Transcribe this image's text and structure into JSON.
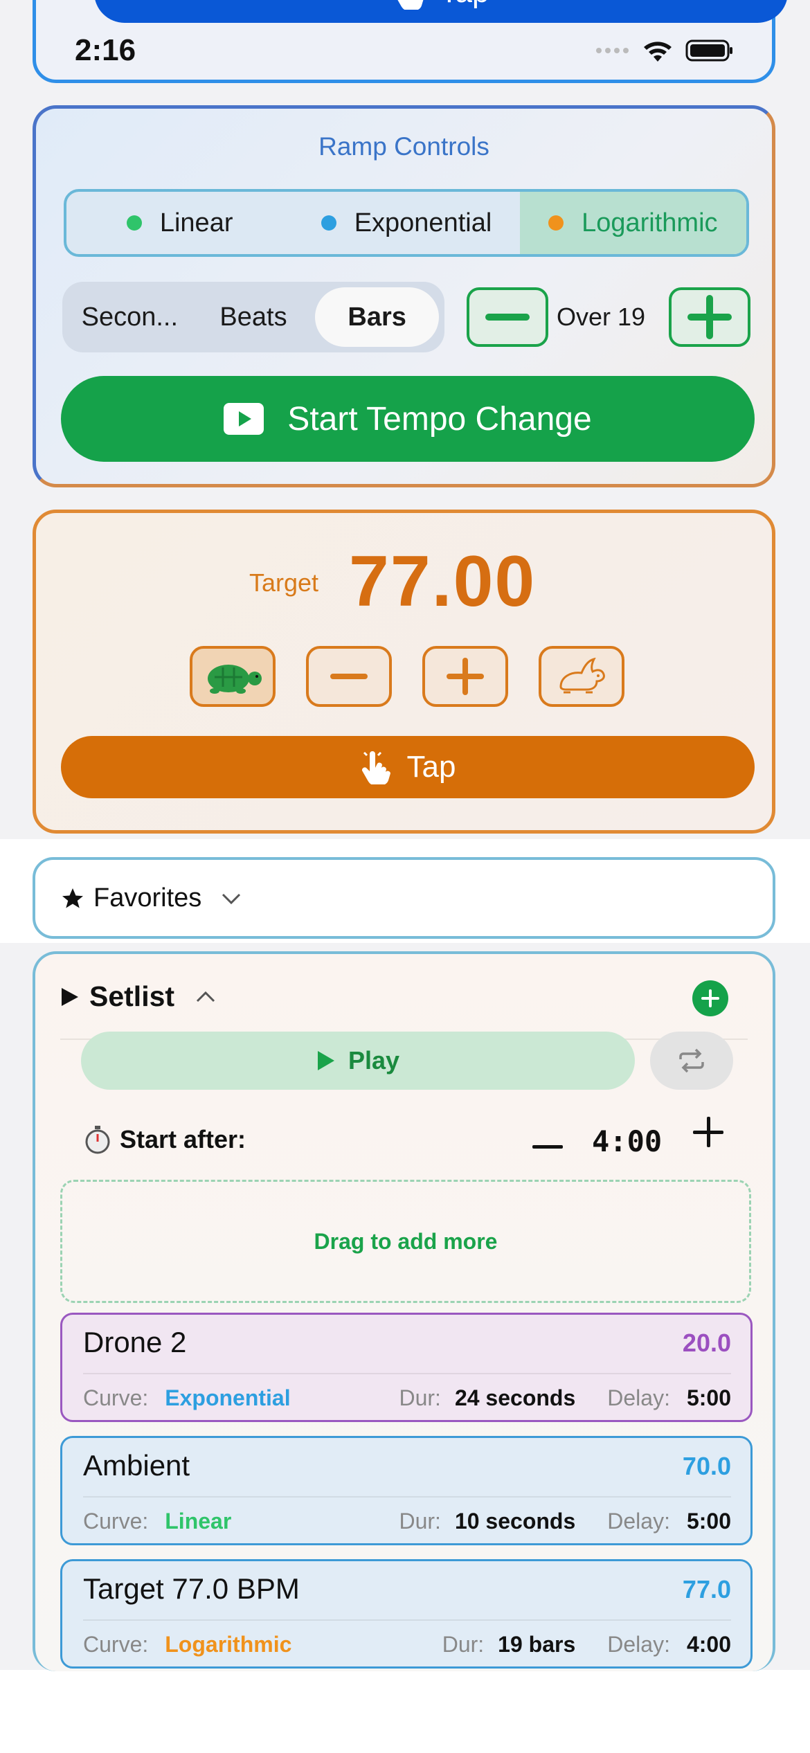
{
  "status_bar": {
    "time": "2:16"
  },
  "top_card": {
    "tap_label": "Tap"
  },
  "ramp": {
    "title": "Ramp Controls",
    "curves": [
      {
        "label": "Linear",
        "dot_color": "#2fc46a",
        "selected": false
      },
      {
        "label": "Exponential",
        "dot_color": "#2d9fe0",
        "selected": false
      },
      {
        "label": "Logarithmic",
        "dot_color": "#f0921c",
        "selected": true
      }
    ],
    "units": [
      {
        "label": "Secon...",
        "selected": false
      },
      {
        "label": "Beats",
        "selected": false
      },
      {
        "label": "Bars",
        "selected": true
      }
    ],
    "duration_label": "Over 19",
    "start_label": "Start Tempo Change"
  },
  "target": {
    "label": "Target",
    "value": "77.00",
    "tap_label": "Tap"
  },
  "favorites": {
    "label": "Favorites"
  },
  "setlist": {
    "title": "Setlist",
    "play_label": "Play",
    "start_after_label": "Start after:",
    "start_after_value": "4:00",
    "drop_zone_label": "Drag to add more",
    "items": [
      {
        "name": "Drone 2",
        "bpm": "20.0",
        "bpm_color": "#9b4fc0",
        "curve_key": "Curve:",
        "curve": "Exponential",
        "curve_color": "#2d9fe0",
        "dur_key": "Dur:",
        "dur": "24 seconds",
        "delay_key": "Delay:",
        "delay": "5:00"
      },
      {
        "name": "Ambient",
        "bpm": "70.0",
        "bpm_color": "#2d9fe0",
        "curve_key": "Curve:",
        "curve": "Linear",
        "curve_color": "#2fc46a",
        "dur_key": "Dur:",
        "dur": "10 seconds",
        "delay_key": "Delay:",
        "delay": "5:00"
      },
      {
        "name": "Target 77.0 BPM",
        "bpm": "77.0",
        "bpm_color": "#2d9fe0",
        "curve_key": "Curve:",
        "curve": "Logarithmic",
        "curve_color": "#f0921c",
        "dur_key": "Dur:",
        "dur": "19 bars",
        "delay_key": "Delay:",
        "delay": "4:00"
      }
    ]
  }
}
